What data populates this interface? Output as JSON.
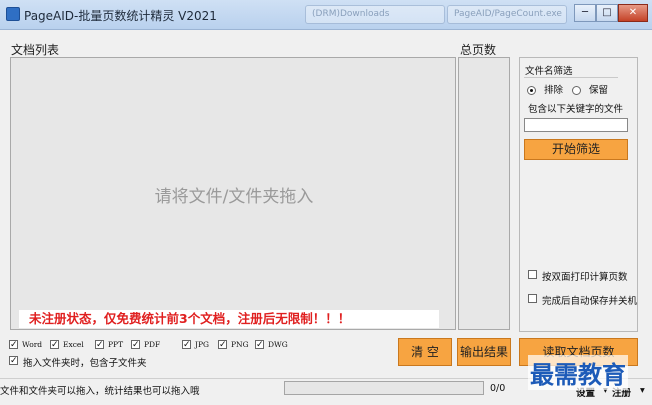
{
  "window": {
    "title": "PageAID-批量页数统计精灵 V2021",
    "ghost_tabs": [
      "(DRM)Downloads",
      "PageAID/PageCount.exe"
    ],
    "min": "─",
    "max": "□",
    "close": "✕"
  },
  "main": {
    "doclist_label": "文档列表",
    "pagecount_label": "总页数",
    "drop_hint": "请将文件/文件夹拖入",
    "reg_notice": "未注册状态，仅免费统计前3个文档，注册后无限制！！！"
  },
  "filter": {
    "title": "文件名筛选",
    "mode_exclude": "排除",
    "mode_keep": "保留",
    "selected_mode": "exclude",
    "keyword_label": "包含以下关键字的文件",
    "keyword_value": "",
    "start_button": "开始筛选",
    "duplex_label": "按双面打印计算页数",
    "auto_shutdown_label": "完成后自动保存并关机"
  },
  "filetypes": [
    {
      "label": "Word",
      "checked": true
    },
    {
      "label": "Excel",
      "checked": true
    },
    {
      "label": "PPT",
      "checked": true
    },
    {
      "label": "PDF",
      "checked": true
    },
    {
      "label": "JPG",
      "checked": true
    },
    {
      "label": "PNG",
      "checked": true
    },
    {
      "label": "DWG",
      "checked": true
    }
  ],
  "include_subfolders": {
    "label": "拖入文件夹时，包含子文件夹",
    "checked": true
  },
  "buttons": {
    "clear": "清 空",
    "export": "输出结果",
    "read_pages": "读取文档页数"
  },
  "status": {
    "hint": "文件和文件夹可以拖入，统计结果也可以拖入哦",
    "progress_text": "0/0",
    "settings": "设置",
    "register": "注册"
  },
  "watermark": "最需教育"
}
